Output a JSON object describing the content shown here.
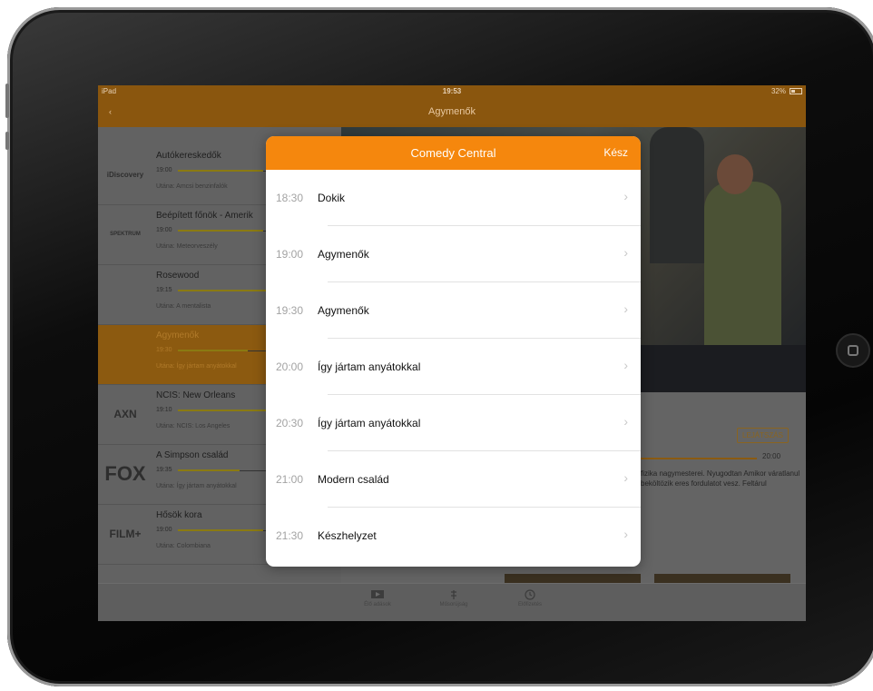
{
  "status": {
    "device": "iPad",
    "time": "19:53",
    "battery": "32%"
  },
  "nav": {
    "title": "Agymenők"
  },
  "channels": [
    {
      "logo": "iDiscovery",
      "show": "Autókereskedők",
      "time": "19:00",
      "next": "Utána: Amcsi benzinfalók",
      "progress": 0.55,
      "active": false
    },
    {
      "logo": "SPEKTRUM",
      "show": "Beépített főnök - Amerik",
      "time": "19:00",
      "next": "Utána: Meteorveszély",
      "progress": 0.55,
      "active": false
    },
    {
      "logo": "",
      "show": "Rosewood",
      "time": "19:15",
      "next": "Utána: A mentalista",
      "progress": 0.7,
      "active": false
    },
    {
      "logo": "",
      "show": "Agymenők",
      "time": "19:30",
      "next": "Utána: Így jártam anyátokkal",
      "progress": 0.45,
      "active": true
    },
    {
      "logo": "AXN",
      "show": "NCIS: New Orleans",
      "time": "19:10",
      "next": "Utána: NCIS: Los Angeles",
      "progress": 0.75,
      "active": false
    },
    {
      "logo": "FOX",
      "show": "A Simpson család",
      "time": "19:35",
      "next": "Utána: Így jártam anyátokkal",
      "progress": 0.4,
      "active": false
    },
    {
      "logo": "FILM+",
      "show": "Hősök kora",
      "time": "19:00",
      "next": "Utána: Colombiana",
      "progress": 0.55,
      "active": false
    }
  ],
  "detail": {
    "play_label": "LEJÁTSZÁS",
    "end_time": "20:00",
    "description": "fizika nagymesterei. Nyugodtan Amikor váratlanul beköltözik eres fordulatot vesz. Feltárul"
  },
  "modal": {
    "title": "Comedy Central",
    "done_label": "Kész",
    "items": [
      {
        "time": "18:30",
        "title": "Dokik"
      },
      {
        "time": "19:00",
        "title": "Agymenők"
      },
      {
        "time": "19:30",
        "title": "Agymenők"
      },
      {
        "time": "20:00",
        "title": "Így jártam anyátokkal"
      },
      {
        "time": "20:30",
        "title": "Így jártam anyátokkal"
      },
      {
        "time": "21:00",
        "title": "Modern család"
      },
      {
        "time": "21:30",
        "title": "Készhelyzet"
      }
    ]
  },
  "tabs": [
    {
      "label": "Élő adások",
      "icon": "live-tv-icon"
    },
    {
      "label": "Műsorújság",
      "icon": "guide-icon"
    },
    {
      "label": "Előfizetés",
      "icon": "clock-icon"
    }
  ]
}
